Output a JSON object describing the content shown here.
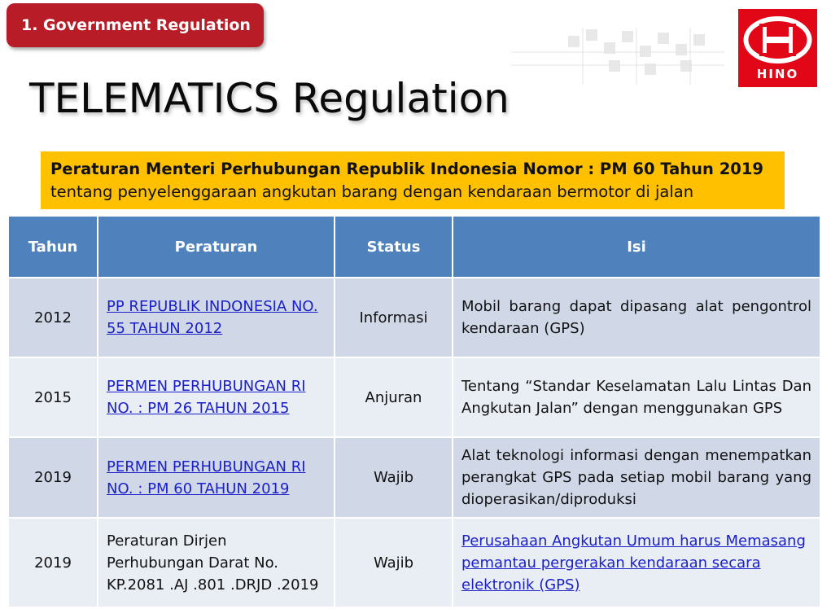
{
  "section_tag": "1. Government Regulation",
  "logo_text": "HINO",
  "page_title": "TELEMATICS Regulation",
  "banner": {
    "line1": "Peraturan Menteri Perhubungan Republik Indonesia Nomor : PM 60 Tahun 2019",
    "line2": "tentang penyelenggaraan angkutan barang dengan kendaraan bermotor di jalan"
  },
  "table": {
    "headers": [
      "Tahun",
      "Peraturan",
      "Status",
      "Isi"
    ],
    "rows": [
      {
        "year": "2012",
        "regulation": "PP REPUBLIK INDONESIA NO. 55 TAHUN 2012",
        "status": "Informasi",
        "content": "Mobil barang dapat dipasang alat pengontrol kendaraan (GPS)"
      },
      {
        "year": "2015",
        "regulation": "PERMEN PERHUBUNGAN RI NO. : PM 26 TAHUN 2015",
        "status": "Anjuran",
        "content": "Tentang “Standar Keselamatan Lalu Lintas Dan Angkutan Jalan” dengan menggunakan GPS"
      },
      {
        "year": "2019",
        "regulation": "PERMEN PERHUBUNGAN RI NO. : PM 60 TAHUN 2019",
        "status": "Wajib",
        "content": "Alat teknologi informasi dengan menempatkan perangkat GPS pada setiap mobil barang yang dioperasikan/diproduksi"
      },
      {
        "year": "2019",
        "regulation": "Peraturan Dirjen Perhubungan Darat No. KP.2081 .AJ .801 .DRJD .2019",
        "status": "Wajib",
        "content": "Perusahaan Angkutan Umum harus Memasang pemantau pergerakan kendaraan secara elektronik (GPS)"
      }
    ]
  },
  "colors": {
    "tag_red": "#b81c27",
    "logo_red": "#e10717",
    "banner_yellow": "#ffc000",
    "header_blue": "#4f81bd",
    "row_dark": "#d0d8e8",
    "row_light": "#e9edf4",
    "link_blue": "#1b20c9"
  }
}
